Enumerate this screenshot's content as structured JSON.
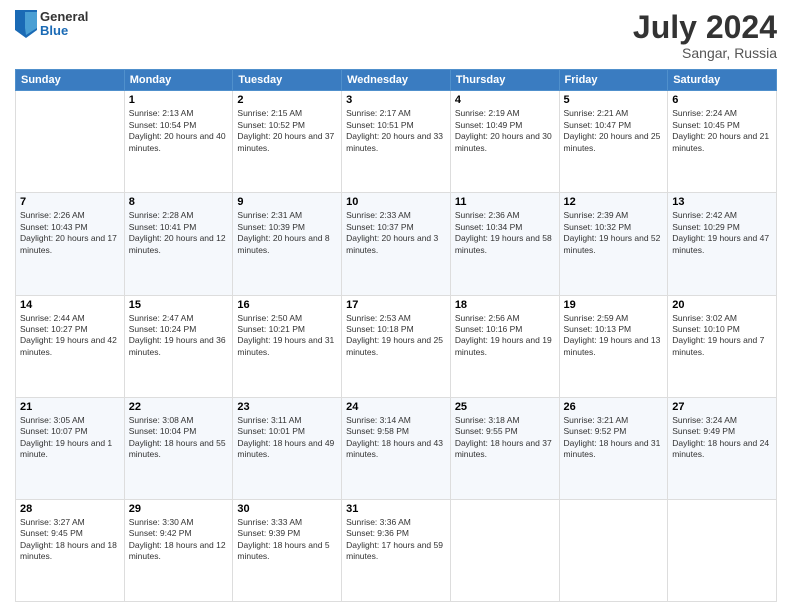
{
  "header": {
    "logo": {
      "general": "General",
      "blue": "Blue"
    },
    "title": "July 2024",
    "location": "Sangar, Russia"
  },
  "weekdays": [
    "Sunday",
    "Monday",
    "Tuesday",
    "Wednesday",
    "Thursday",
    "Friday",
    "Saturday"
  ],
  "weeks": [
    [
      {
        "day": "",
        "sunrise": "",
        "sunset": "",
        "daylight": ""
      },
      {
        "day": "1",
        "sunrise": "Sunrise: 2:13 AM",
        "sunset": "Sunset: 10:54 PM",
        "daylight": "Daylight: 20 hours and 40 minutes."
      },
      {
        "day": "2",
        "sunrise": "Sunrise: 2:15 AM",
        "sunset": "Sunset: 10:52 PM",
        "daylight": "Daylight: 20 hours and 37 minutes."
      },
      {
        "day": "3",
        "sunrise": "Sunrise: 2:17 AM",
        "sunset": "Sunset: 10:51 PM",
        "daylight": "Daylight: 20 hours and 33 minutes."
      },
      {
        "day": "4",
        "sunrise": "Sunrise: 2:19 AM",
        "sunset": "Sunset: 10:49 PM",
        "daylight": "Daylight: 20 hours and 30 minutes."
      },
      {
        "day": "5",
        "sunrise": "Sunrise: 2:21 AM",
        "sunset": "Sunset: 10:47 PM",
        "daylight": "Daylight: 20 hours and 25 minutes."
      },
      {
        "day": "6",
        "sunrise": "Sunrise: 2:24 AM",
        "sunset": "Sunset: 10:45 PM",
        "daylight": "Daylight: 20 hours and 21 minutes."
      }
    ],
    [
      {
        "day": "7",
        "sunrise": "Sunrise: 2:26 AM",
        "sunset": "Sunset: 10:43 PM",
        "daylight": "Daylight: 20 hours and 17 minutes."
      },
      {
        "day": "8",
        "sunrise": "Sunrise: 2:28 AM",
        "sunset": "Sunset: 10:41 PM",
        "daylight": "Daylight: 20 hours and 12 minutes."
      },
      {
        "day": "9",
        "sunrise": "Sunrise: 2:31 AM",
        "sunset": "Sunset: 10:39 PM",
        "daylight": "Daylight: 20 hours and 8 minutes."
      },
      {
        "day": "10",
        "sunrise": "Sunrise: 2:33 AM",
        "sunset": "Sunset: 10:37 PM",
        "daylight": "Daylight: 20 hours and 3 minutes."
      },
      {
        "day": "11",
        "sunrise": "Sunrise: 2:36 AM",
        "sunset": "Sunset: 10:34 PM",
        "daylight": "Daylight: 19 hours and 58 minutes."
      },
      {
        "day": "12",
        "sunrise": "Sunrise: 2:39 AM",
        "sunset": "Sunset: 10:32 PM",
        "daylight": "Daylight: 19 hours and 52 minutes."
      },
      {
        "day": "13",
        "sunrise": "Sunrise: 2:42 AM",
        "sunset": "Sunset: 10:29 PM",
        "daylight": "Daylight: 19 hours and 47 minutes."
      }
    ],
    [
      {
        "day": "14",
        "sunrise": "Sunrise: 2:44 AM",
        "sunset": "Sunset: 10:27 PM",
        "daylight": "Daylight: 19 hours and 42 minutes."
      },
      {
        "day": "15",
        "sunrise": "Sunrise: 2:47 AM",
        "sunset": "Sunset: 10:24 PM",
        "daylight": "Daylight: 19 hours and 36 minutes."
      },
      {
        "day": "16",
        "sunrise": "Sunrise: 2:50 AM",
        "sunset": "Sunset: 10:21 PM",
        "daylight": "Daylight: 19 hours and 31 minutes."
      },
      {
        "day": "17",
        "sunrise": "Sunrise: 2:53 AM",
        "sunset": "Sunset: 10:18 PM",
        "daylight": "Daylight: 19 hours and 25 minutes."
      },
      {
        "day": "18",
        "sunrise": "Sunrise: 2:56 AM",
        "sunset": "Sunset: 10:16 PM",
        "daylight": "Daylight: 19 hours and 19 minutes."
      },
      {
        "day": "19",
        "sunrise": "Sunrise: 2:59 AM",
        "sunset": "Sunset: 10:13 PM",
        "daylight": "Daylight: 19 hours and 13 minutes."
      },
      {
        "day": "20",
        "sunrise": "Sunrise: 3:02 AM",
        "sunset": "Sunset: 10:10 PM",
        "daylight": "Daylight: 19 hours and 7 minutes."
      }
    ],
    [
      {
        "day": "21",
        "sunrise": "Sunrise: 3:05 AM",
        "sunset": "Sunset: 10:07 PM",
        "daylight": "Daylight: 19 hours and 1 minute."
      },
      {
        "day": "22",
        "sunrise": "Sunrise: 3:08 AM",
        "sunset": "Sunset: 10:04 PM",
        "daylight": "Daylight: 18 hours and 55 minutes."
      },
      {
        "day": "23",
        "sunrise": "Sunrise: 3:11 AM",
        "sunset": "Sunset: 10:01 PM",
        "daylight": "Daylight: 18 hours and 49 minutes."
      },
      {
        "day": "24",
        "sunrise": "Sunrise: 3:14 AM",
        "sunset": "Sunset: 9:58 PM",
        "daylight": "Daylight: 18 hours and 43 minutes."
      },
      {
        "day": "25",
        "sunrise": "Sunrise: 3:18 AM",
        "sunset": "Sunset: 9:55 PM",
        "daylight": "Daylight: 18 hours and 37 minutes."
      },
      {
        "day": "26",
        "sunrise": "Sunrise: 3:21 AM",
        "sunset": "Sunset: 9:52 PM",
        "daylight": "Daylight: 18 hours and 31 minutes."
      },
      {
        "day": "27",
        "sunrise": "Sunrise: 3:24 AM",
        "sunset": "Sunset: 9:49 PM",
        "daylight": "Daylight: 18 hours and 24 minutes."
      }
    ],
    [
      {
        "day": "28",
        "sunrise": "Sunrise: 3:27 AM",
        "sunset": "Sunset: 9:45 PM",
        "daylight": "Daylight: 18 hours and 18 minutes."
      },
      {
        "day": "29",
        "sunrise": "Sunrise: 3:30 AM",
        "sunset": "Sunset: 9:42 PM",
        "daylight": "Daylight: 18 hours and 12 minutes."
      },
      {
        "day": "30",
        "sunrise": "Sunrise: 3:33 AM",
        "sunset": "Sunset: 9:39 PM",
        "daylight": "Daylight: 18 hours and 5 minutes."
      },
      {
        "day": "31",
        "sunrise": "Sunrise: 3:36 AM",
        "sunset": "Sunset: 9:36 PM",
        "daylight": "Daylight: 17 hours and 59 minutes."
      },
      {
        "day": "",
        "sunrise": "",
        "sunset": "",
        "daylight": ""
      },
      {
        "day": "",
        "sunrise": "",
        "sunset": "",
        "daylight": ""
      },
      {
        "day": "",
        "sunrise": "",
        "sunset": "",
        "daylight": ""
      }
    ]
  ]
}
